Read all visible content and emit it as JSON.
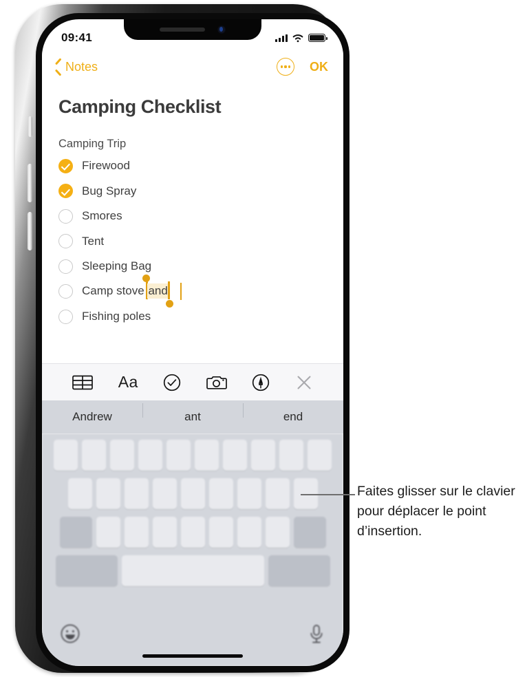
{
  "status_bar": {
    "time": "09:41",
    "cellular_icon": "signal-bars-icon",
    "wifi_icon": "wifi-icon",
    "battery_icon": "battery-icon"
  },
  "nav_bar": {
    "back_icon": "chevron-left-icon",
    "back_label": "Notes",
    "more_icon": "more-ellipsis-icon",
    "done_label": "OK"
  },
  "note": {
    "title": "Camping Checklist",
    "section_heading": "Camping Trip",
    "items": [
      {
        "label": "Firewood",
        "checked": true
      },
      {
        "label": "Bug Spray",
        "checked": true
      },
      {
        "label": "Smores",
        "checked": false
      },
      {
        "label": "Tent",
        "checked": false
      },
      {
        "label": "Sleeping Bag",
        "checked": false
      },
      {
        "label": "Camp stove ",
        "checked": false
      },
      {
        "label": "Fishing poles",
        "checked": false
      }
    ],
    "editing_row": {
      "prefix": "Camp stove ",
      "selected_text": "and"
    }
  },
  "format_toolbar": {
    "table_icon": "table-icon",
    "text_style_label": "Aa",
    "checklist_icon": "checkmark-circle-icon",
    "camera_icon": "camera-icon",
    "markup_icon": "markup-pen-icon",
    "close_icon": "close-x-icon"
  },
  "predictive_bar": {
    "suggestions": [
      "Andrew",
      "ant",
      "end"
    ]
  },
  "keyboard": {
    "emoji_icon": "emoji-smiley-icon",
    "dictation_icon": "microphone-icon"
  },
  "callout": {
    "text": "Faites glisser sur le clavier pour déplacer le point d’insertion."
  },
  "colors": {
    "accent": "#EFAF17",
    "checkbox_filled": "#F5B014",
    "selection_highlight": "#FBEFD2",
    "selection_handle": "#E2A114",
    "keyboard_bg": "#d3d6dc",
    "key_bg": "#e9eaee",
    "key_dark_bg": "#bcc0c8"
  }
}
